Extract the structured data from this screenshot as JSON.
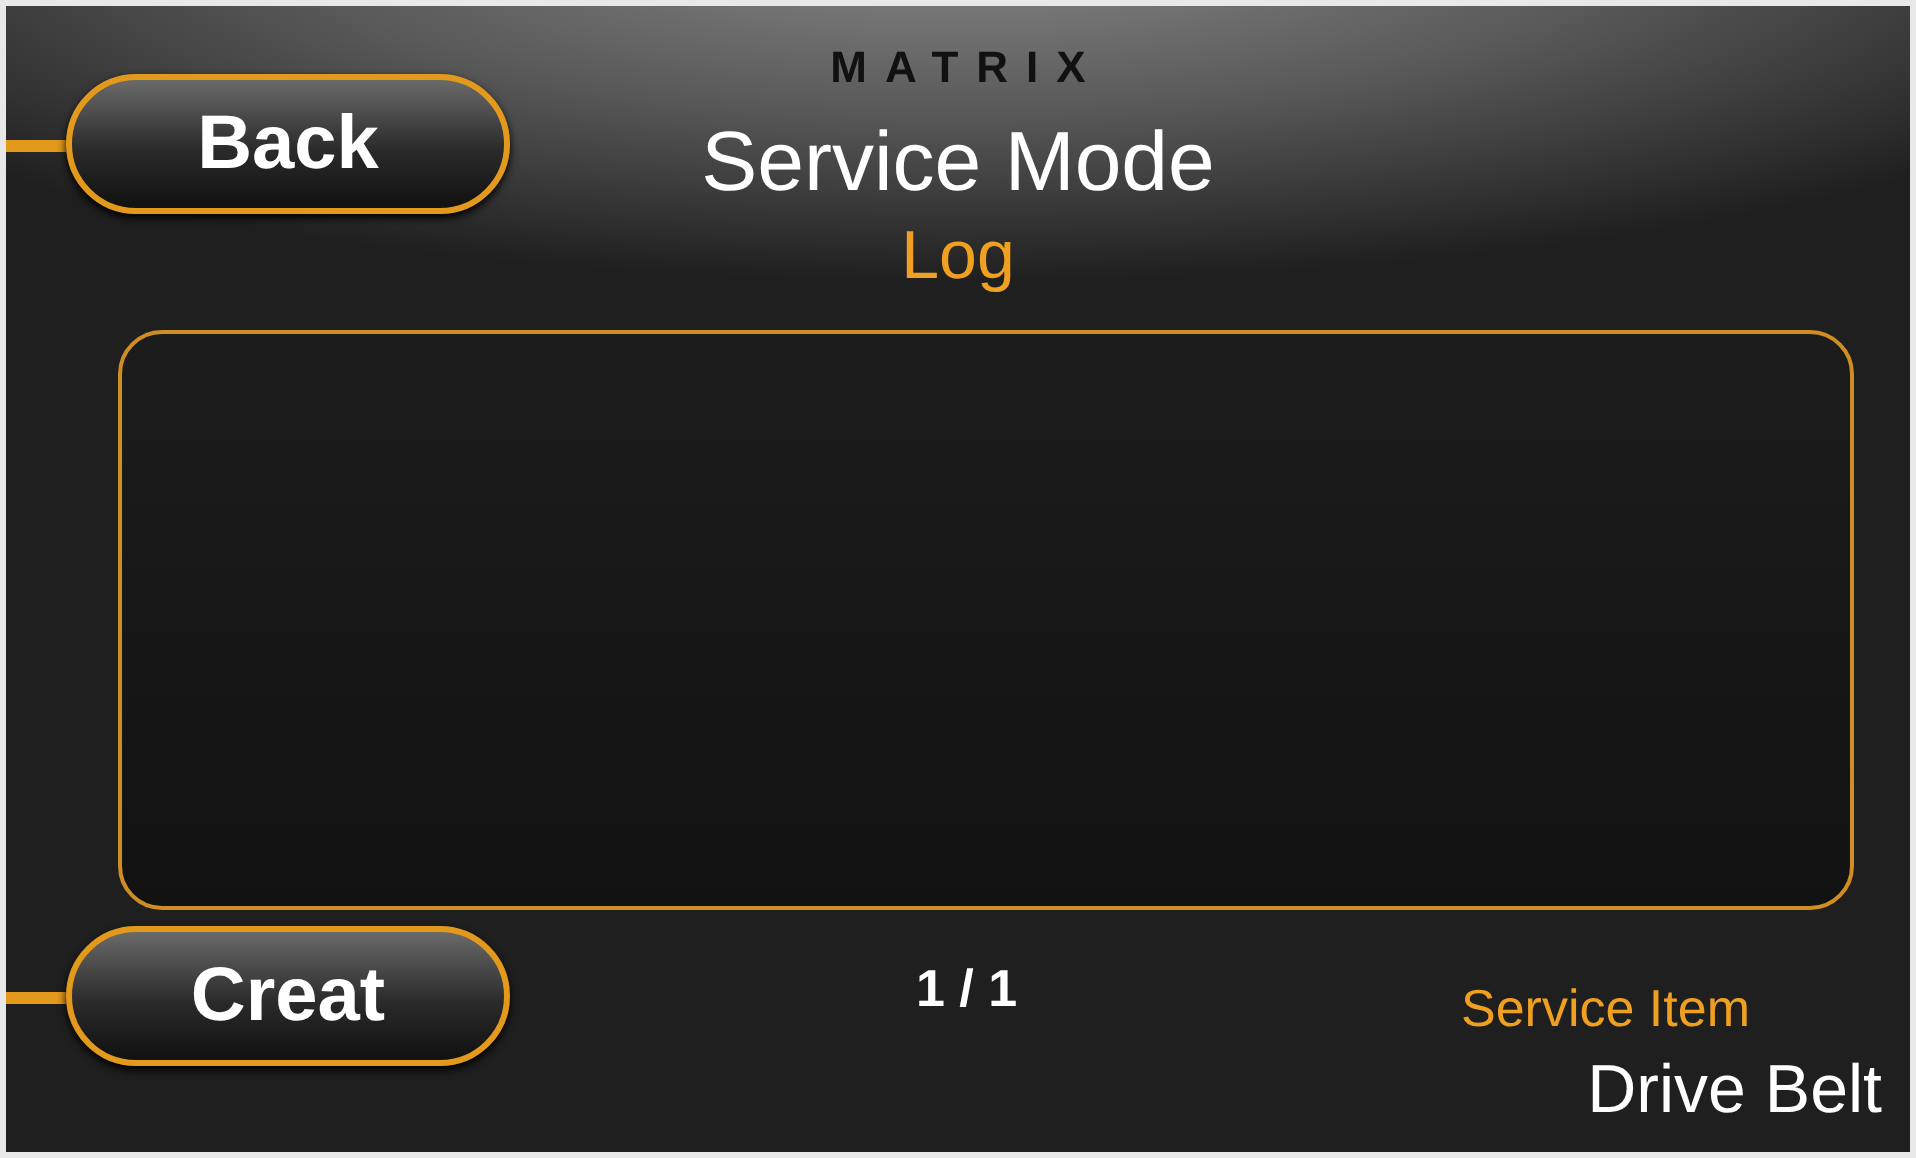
{
  "header": {
    "logo": "MATRIX",
    "title": "Service Mode",
    "subtitle": "Log"
  },
  "back_button": {
    "label": "Back"
  },
  "create_button": {
    "label": "Creat"
  },
  "page_indicator": "1 / 1",
  "service_item": {
    "label": "Service Item",
    "value": "Drive Belt"
  }
}
